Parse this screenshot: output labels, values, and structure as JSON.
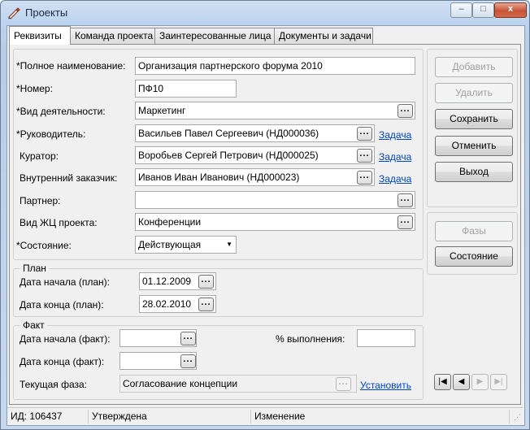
{
  "window": {
    "title": "Проекты",
    "minimize": "‒",
    "maximize": "□",
    "close": "x"
  },
  "tabs": [
    "Реквизиты",
    "Команда проекта",
    "Заинтересованные лица",
    "Документы и задачи"
  ],
  "fields": {
    "full_name": {
      "label": "*Полное наименование:",
      "value": "Организация партнерского форума 2010"
    },
    "number": {
      "label": "*Номер:",
      "value": "ПФ10"
    },
    "activity": {
      "label": "*Вид деятельности:",
      "value": "Маркетинг"
    },
    "manager": {
      "label": "*Руководитель:",
      "value": "Васильев Павел Сергеевич (НД000036)",
      "link": "Задача"
    },
    "curator": {
      "label": "Куратор:",
      "value": "Воробьев Сергей Петрович (НД000025)",
      "link": "Задача"
    },
    "internal_customer": {
      "label": "Внутренний заказчик:",
      "value": "Иванов Иван Иванович (НД000023)",
      "link": "Задача"
    },
    "partner": {
      "label": "Партнер:",
      "value": ""
    },
    "lifecycle": {
      "label": "Вид ЖЦ проекта:",
      "value": "Конференции"
    },
    "state": {
      "label": "*Состояние:",
      "value": "Действующая"
    }
  },
  "plan": {
    "title": "План",
    "start_label": "Дата начала (план):",
    "start_value": "01.12.2009",
    "end_label": "Дата конца (план):",
    "end_value": "28.02.2010"
  },
  "fact": {
    "title": "Факт",
    "start_label": "Дата начала (факт):",
    "start_value": "",
    "end_label": "Дата конца (факт):",
    "end_value": "",
    "progress_label": "% выполнения:",
    "progress_value": "",
    "phase_label": "Текущая фаза:",
    "phase_value": "Согласование концепции",
    "phase_link": "Установить"
  },
  "buttons": {
    "add": "Добавить",
    "delete": "Удалить",
    "save": "Сохранить",
    "cancel": "Отменить",
    "exit": "Выход",
    "phases": "Фазы",
    "state": "Состояние"
  },
  "nav": {
    "first": "|◀",
    "prev": "◀",
    "next": "▶",
    "last": "▶|"
  },
  "status": {
    "id": "ИД: 106437",
    "approval": "Утверждена",
    "mode": "Изменение"
  },
  "dots": "..."
}
